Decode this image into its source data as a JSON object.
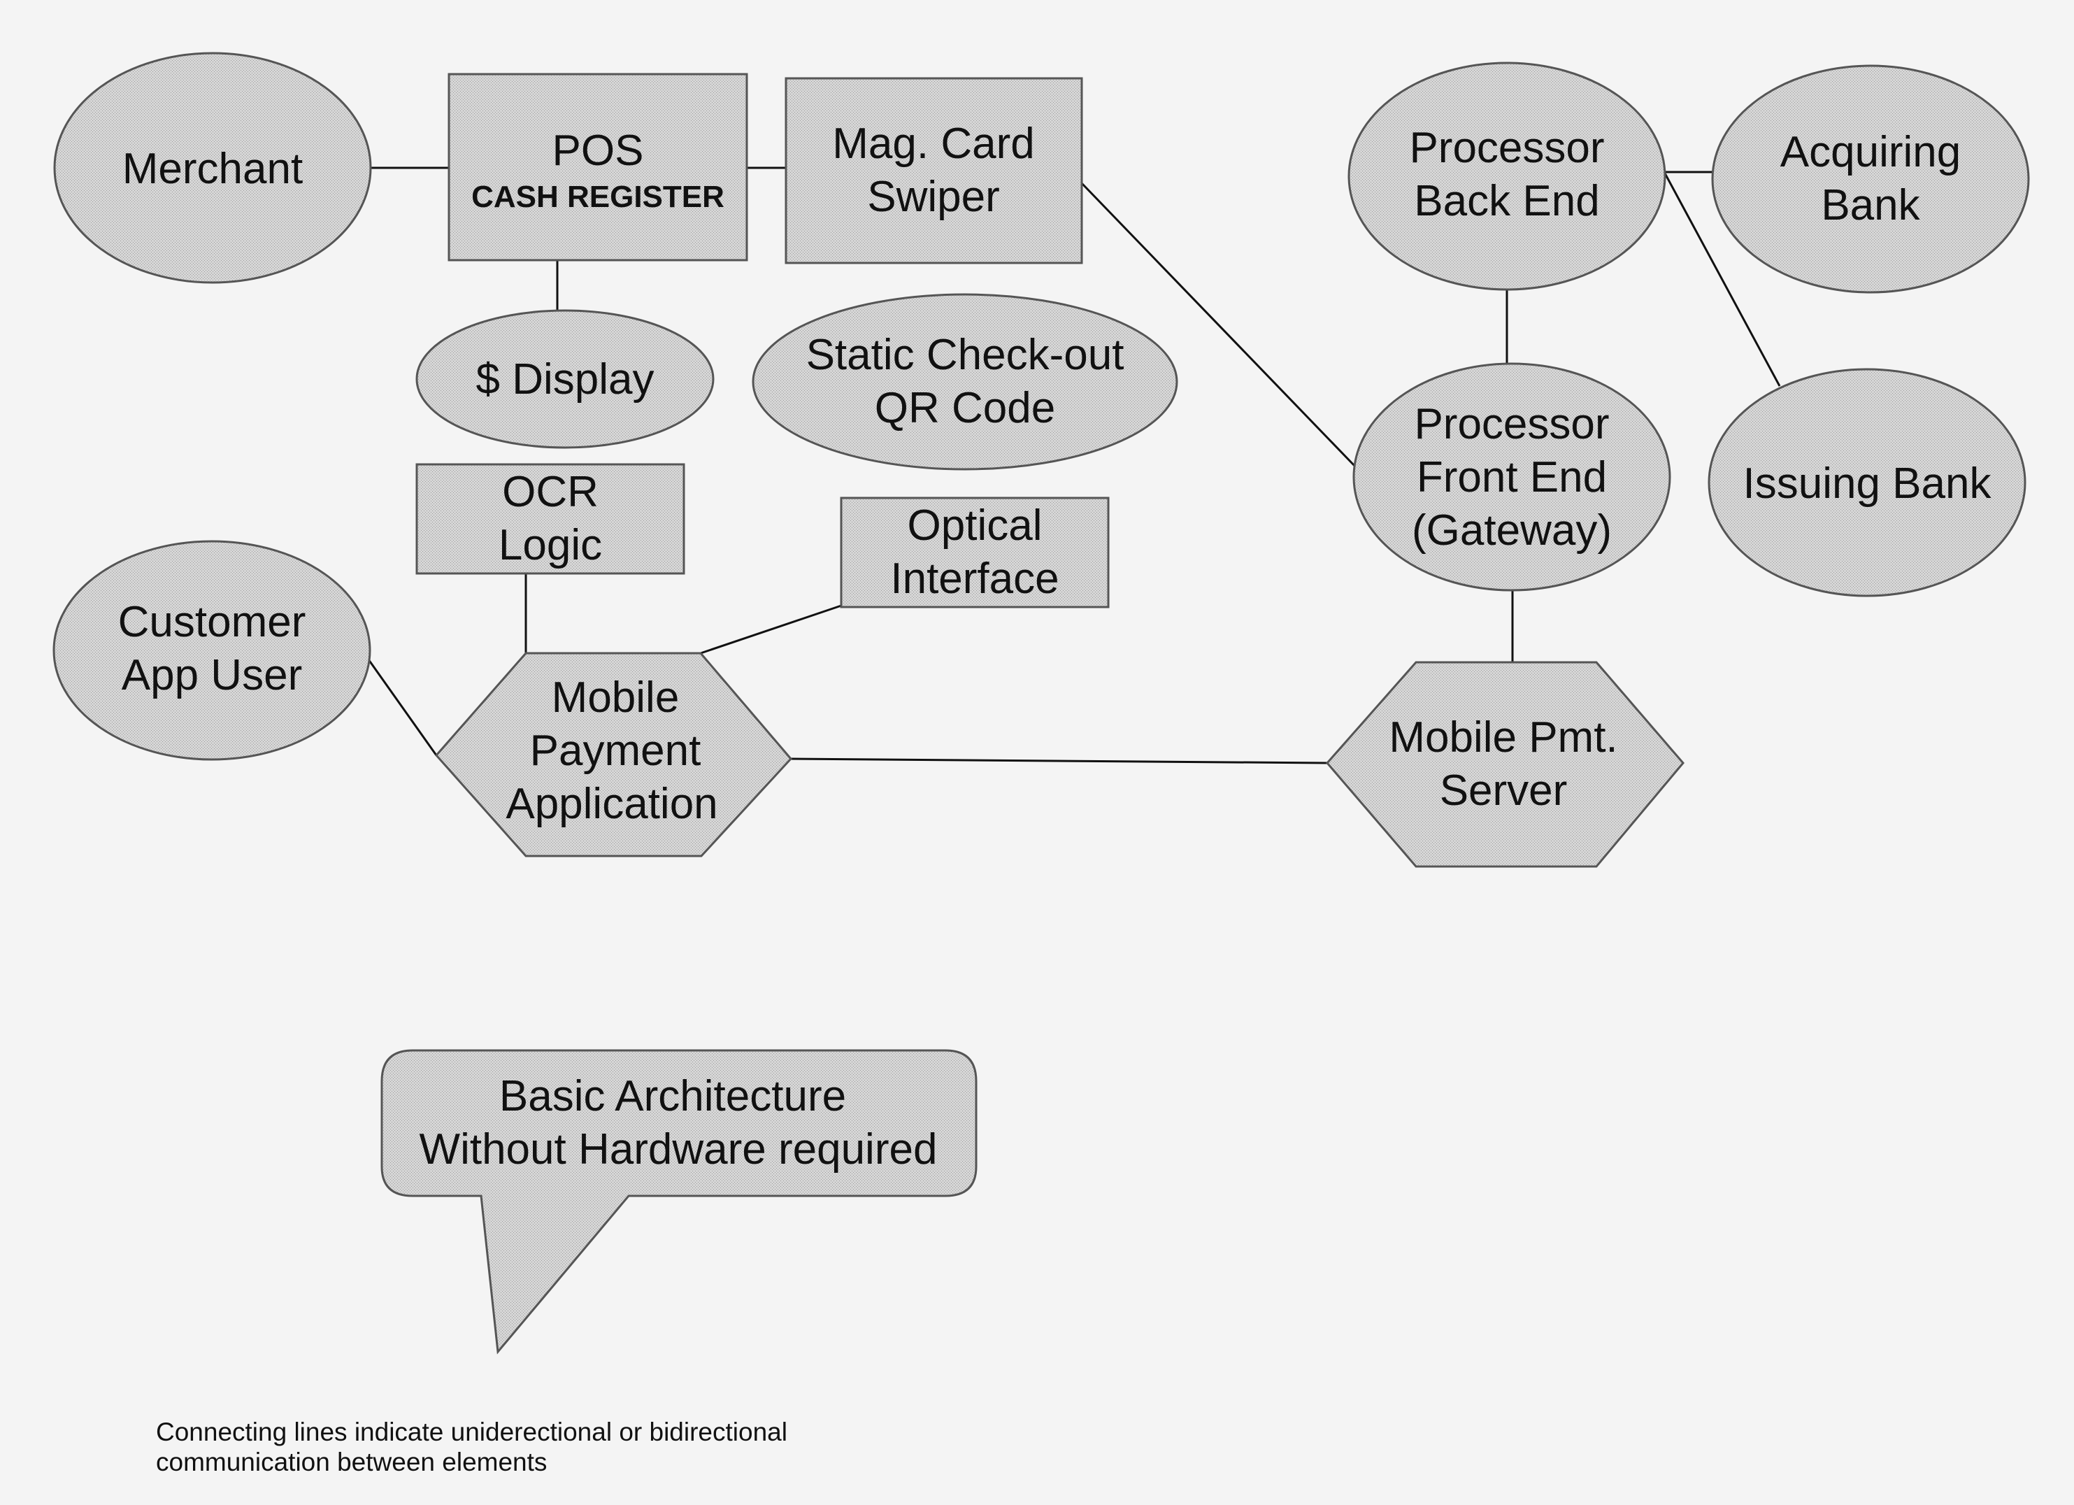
{
  "diagram": {
    "nodes": {
      "merchant": {
        "lines": [
          "Merchant"
        ],
        "shape": "ellipse"
      },
      "pos": {
        "lines": [
          "POS"
        ],
        "subtitle": "CASH REGISTER",
        "shape": "rectangle"
      },
      "mag_card": {
        "lines": [
          "Mag. Card",
          "Swiper"
        ],
        "shape": "rectangle"
      },
      "display": {
        "lines": [
          "$ Display"
        ],
        "shape": "ellipse"
      },
      "static_qr": {
        "lines": [
          "Static Check-out",
          "QR Code"
        ],
        "shape": "ellipse"
      },
      "ocr": {
        "lines": [
          "OCR",
          "Logic"
        ],
        "shape": "rectangle"
      },
      "optical": {
        "lines": [
          "Optical",
          "Interface"
        ],
        "shape": "rectangle"
      },
      "customer": {
        "lines": [
          "Customer",
          "App User"
        ],
        "shape": "ellipse"
      },
      "mobile_app": {
        "lines": [
          "Mobile",
          "Payment",
          "Application"
        ],
        "shape": "hexagon"
      },
      "mobile_server": {
        "lines": [
          "Mobile Pmt.",
          "Server"
        ],
        "shape": "hexagon"
      },
      "proc_back": {
        "lines": [
          "Processor",
          "Back End"
        ],
        "shape": "ellipse"
      },
      "proc_front": {
        "lines": [
          "Processor",
          "Front End",
          "(Gateway)"
        ],
        "shape": "ellipse"
      },
      "acquiring": {
        "lines": [
          "Acquiring",
          "Bank"
        ],
        "shape": "ellipse"
      },
      "issuing": {
        "lines": [
          "Issuing Bank"
        ],
        "shape": "ellipse"
      }
    },
    "edges": [
      [
        "merchant",
        "pos"
      ],
      [
        "pos",
        "mag_card"
      ],
      [
        "pos",
        "display"
      ],
      [
        "mag_card",
        "proc_front"
      ],
      [
        "ocr",
        "mobile_app"
      ],
      [
        "optical",
        "mobile_app"
      ],
      [
        "customer",
        "mobile_app"
      ],
      [
        "mobile_app",
        "mobile_server"
      ],
      [
        "proc_back",
        "proc_front"
      ],
      [
        "proc_back",
        "acquiring"
      ],
      [
        "proc_back",
        "issuing"
      ],
      [
        "proc_front",
        "mobile_server"
      ]
    ],
    "callout": {
      "lines": [
        "Basic Architecture",
        "Without Hardware required"
      ]
    },
    "caption": {
      "lines": [
        "Connecting lines indicate uniderectional or bidirectional",
        "communication between elements"
      ]
    },
    "colors": {
      "background": "#f4f4f4",
      "shape_fill": "#cfcfcf",
      "stroke": "#111111"
    }
  }
}
